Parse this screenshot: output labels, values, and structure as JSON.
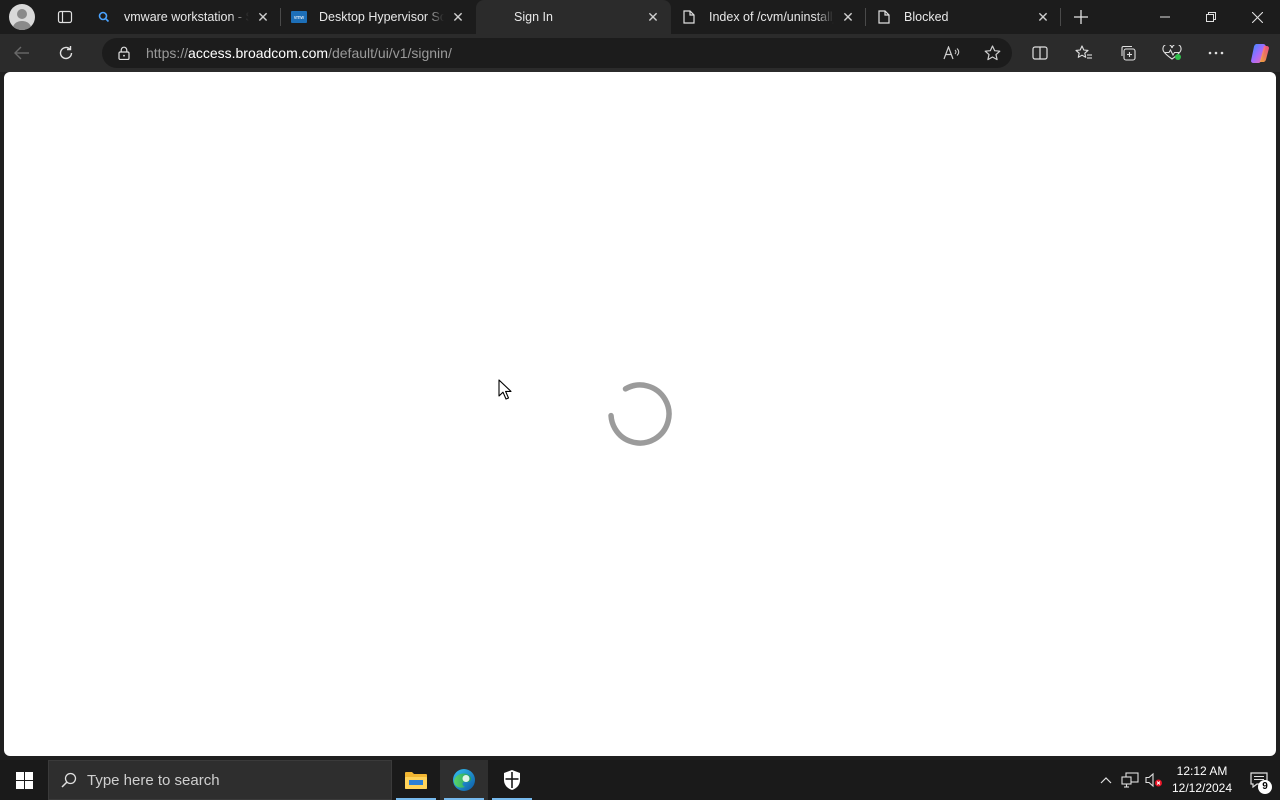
{
  "browser": {
    "tabs": [
      {
        "title": "vmware workstation - Sea",
        "favicon": "search-icon",
        "active": false
      },
      {
        "title": "Desktop Hypervisor Solut",
        "favicon": "vmware-icon",
        "active": false
      },
      {
        "title": "Sign In",
        "favicon": "none",
        "active": true
      },
      {
        "title": "Index of /cvm/uninstall_n",
        "favicon": "page-icon",
        "active": false
      },
      {
        "title": "Blocked",
        "favicon": "page-icon",
        "active": false
      }
    ],
    "address": {
      "prefix": "https://",
      "host": "access.broadcom.com",
      "path": "/default/ui/v1/signin/"
    }
  },
  "page": {
    "state": "loading-spinner"
  },
  "taskbar": {
    "search_placeholder": "Type here to search",
    "clock_time": "12:12 AM",
    "clock_date": "12/12/2024",
    "notification_count": "9"
  }
}
